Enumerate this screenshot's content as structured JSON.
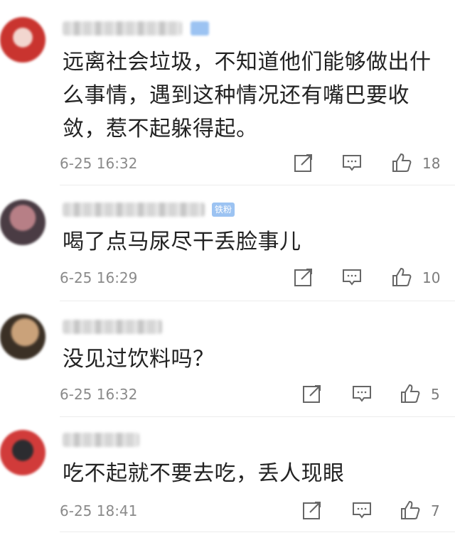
{
  "comments": [
    {
      "text": "远离社会垃圾，不知道他们能够做出什么事情，遇到这种情况还有嘴巴要收敛，惹不起躲得起。",
      "time": "6-25 16:32",
      "likes": "18",
      "avatar_colors": [
        "#c9342f",
        "#f2d6cf"
      ]
    },
    {
      "text": "喝了点马尿尽干丢脸事儿",
      "time": "6-25 16:29",
      "likes": "10",
      "badge": "铁粉",
      "avatar_colors": [
        "#b77f86",
        "#4a3c44"
      ]
    },
    {
      "text": "没见过饮料吗？",
      "time": "6-25 16:32",
      "likes": "5",
      "avatar_colors": [
        "#caa27a",
        "#3b3025"
      ]
    },
    {
      "text": "吃不起就不要去吃，丢人现眼",
      "time": "6-25 18:41",
      "likes": "7",
      "avatar_colors": [
        "#d13b3a",
        "#2c2c30"
      ]
    }
  ],
  "icons": {
    "share": "share-icon",
    "reply": "reply-icon",
    "like": "thumbs-up-icon"
  },
  "colors": {
    "badge": "#9cc3f2",
    "meta_text": "#8a8a8a",
    "divider": "#ececec"
  }
}
